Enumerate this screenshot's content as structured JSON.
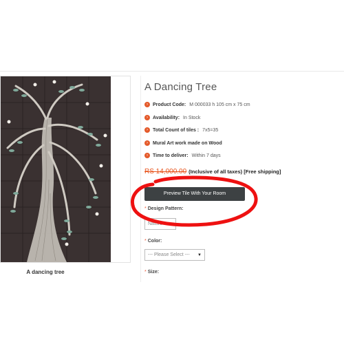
{
  "product": {
    "title": "A Dancing Tree",
    "image_caption": "A dancing tree"
  },
  "specs": [
    {
      "label": "Product Code:",
      "value": "M 000033 h 105 cm x 75 cm"
    },
    {
      "label": "Availability:",
      "value": "In Stock"
    },
    {
      "label": "Total Count of tiles :",
      "value": "7x5=35"
    },
    {
      "label": "Mural Art work made on Wood",
      "value": ""
    },
    {
      "label": "Time to deliver:",
      "value": "Within 7 days"
    }
  ],
  "price": {
    "amount": "RS 14,000.00",
    "note": "(Inclusive of all taxes) [Free shipping]"
  },
  "preview_button": {
    "label": "Preview Tile With Your Room"
  },
  "options": {
    "design_pattern": {
      "label": "Design Pattern:",
      "selected": "Nature"
    },
    "color": {
      "label": "Color:",
      "selected": "--- Please Select ---"
    },
    "size": {
      "label": "Size:"
    }
  },
  "colors": {
    "accent": "#e45a2a",
    "price": "#e8531b",
    "button": "#3d4143",
    "annotation_circle": "#ee1111",
    "tile_background": "#3a3131"
  },
  "icons": {
    "spec_bullet": "chevron-right-circle-icon",
    "select_arrow": "caret-down-icon"
  }
}
